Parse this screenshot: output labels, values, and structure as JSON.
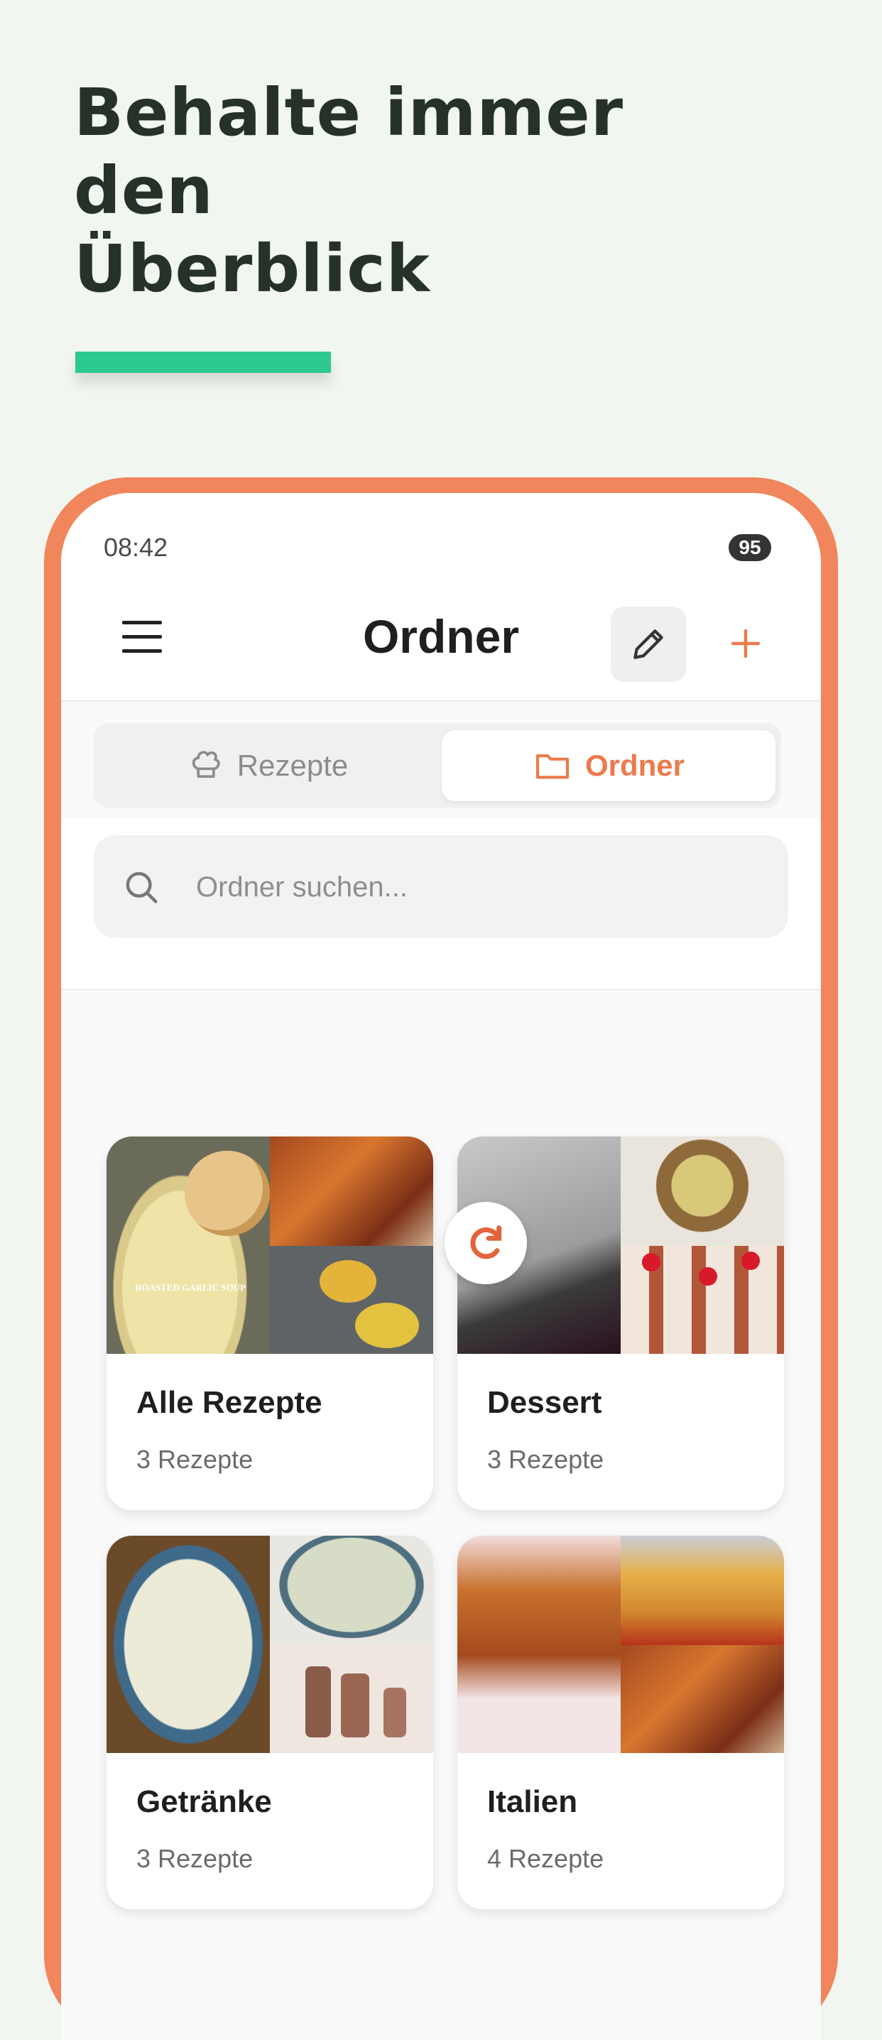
{
  "headline": {
    "line1": "Behalte immer den",
    "line2": "Überblick"
  },
  "colors": {
    "accent_green": "#2ec98e",
    "phone_frame": "#f1855b",
    "brand_orange": "#ec7a4c",
    "headline": "#263228",
    "background": "#f1f7f0"
  },
  "status_bar": {
    "time": "08:42",
    "battery": "95"
  },
  "app_bar": {
    "title": "Ordner",
    "menu_icon": "menu-icon",
    "edit_icon": "pencil-icon",
    "add_icon": "plus-icon"
  },
  "tabs": [
    {
      "label": "Rezepte",
      "icon": "chef-hat-icon",
      "active": false
    },
    {
      "label": "Ordner",
      "icon": "folder-icon",
      "active": true
    }
  ],
  "search": {
    "placeholder": "Ordner suchen...",
    "value": ""
  },
  "folders": [
    {
      "title": "Alle Rezepte",
      "count": "3 Rezepte"
    },
    {
      "title": "Dessert",
      "count": "3 Rezepte"
    },
    {
      "title": "Getränke",
      "count": "3 Rezepte"
    },
    {
      "title": "Italien",
      "count": "4 Rezepte"
    }
  ],
  "collage_overlay_text": "ROASTED GARLIC SOUP",
  "sync_icon": "sync-icon"
}
